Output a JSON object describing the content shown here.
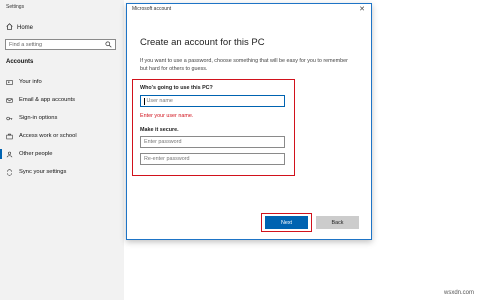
{
  "settings": {
    "window_title": "Settings",
    "home_label": "Home",
    "search_placeholder": "Find a setting",
    "section_title": "Accounts",
    "nav_items": [
      {
        "label": "Your info"
      },
      {
        "label": "Email & app accounts"
      },
      {
        "label": "Sign-in options"
      },
      {
        "label": "Access work or school"
      },
      {
        "label": "Other people"
      },
      {
        "label": "Sync your settings"
      }
    ]
  },
  "dialog": {
    "title": "Microsoft account",
    "heading": "Create an account for this PC",
    "description": "If you want to use a password, choose something that will be easy for you to remember but hard for others to guess.",
    "who_label": "Who's going to use this PC?",
    "username_placeholder": "User name",
    "error_text": "Enter your user name.",
    "secure_label": "Make it secure.",
    "password_placeholder": "Enter password",
    "reenter_placeholder": "Re-enter password",
    "next_label": "Next",
    "back_label": "Back"
  },
  "watermark": "wsxdn.com",
  "colors": {
    "accent": "#0063b1",
    "error": "#d1121c"
  }
}
